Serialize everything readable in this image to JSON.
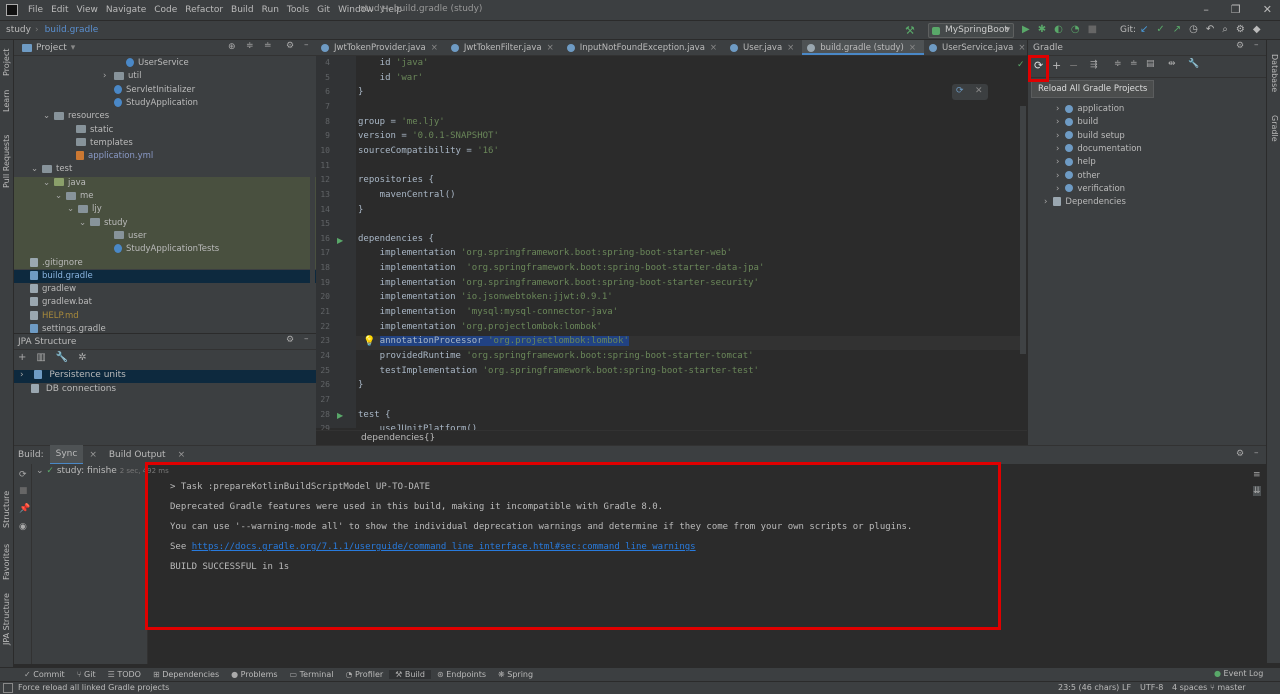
{
  "window": {
    "title": "study - build.gradle (study)"
  },
  "menu": [
    "File",
    "Edit",
    "View",
    "Navigate",
    "Code",
    "Refactor",
    "Build",
    "Run",
    "Tools",
    "Git",
    "Window",
    "Help"
  ],
  "nav": {
    "project": "study",
    "file": "build.gradle",
    "run_config": "MySpringBoot",
    "git_label": "Git:"
  },
  "project_panel": {
    "title": "Project",
    "tree": [
      {
        "label": "UserService",
        "indent": 126,
        "kind": "class"
      },
      {
        "label": "util",
        "indent": 114,
        "kind": "folder",
        "chev": "›"
      },
      {
        "label": "ServletInitializer",
        "indent": 114,
        "kind": "class"
      },
      {
        "label": "StudyApplication",
        "indent": 114,
        "kind": "class"
      },
      {
        "label": "resources",
        "indent": 54,
        "kind": "folder",
        "chev": "⌄"
      },
      {
        "label": "static",
        "indent": 76,
        "kind": "folder"
      },
      {
        "label": "templates",
        "indent": 76,
        "kind": "folder"
      },
      {
        "label": "application.yml",
        "indent": 76,
        "kind": "yml"
      },
      {
        "label": "test",
        "indent": 42,
        "kind": "folder",
        "chev": "⌄"
      },
      {
        "label": "java",
        "indent": 54,
        "kind": "folderg",
        "chev": "⌄"
      },
      {
        "label": "me",
        "indent": 66,
        "kind": "folder",
        "chev": "⌄"
      },
      {
        "label": "ljy",
        "indent": 78,
        "kind": "folder",
        "chev": "⌄"
      },
      {
        "label": "study",
        "indent": 90,
        "kind": "folder",
        "chev": "⌄"
      },
      {
        "label": "user",
        "indent": 114,
        "kind": "folder"
      },
      {
        "label": "StudyApplicationTests",
        "indent": 114,
        "kind": "class"
      },
      {
        "label": ".gitignore",
        "indent": 30,
        "kind": "file"
      },
      {
        "label": "build.gradle",
        "indent": 30,
        "kind": "gradle"
      },
      {
        "label": "gradlew",
        "indent": 30,
        "kind": "file"
      },
      {
        "label": "gradlew.bat",
        "indent": 30,
        "kind": "file"
      },
      {
        "label": "HELP.md",
        "indent": 30,
        "kind": "md"
      },
      {
        "label": "settings.gradle",
        "indent": 30,
        "kind": "gradle"
      }
    ]
  },
  "jpa_panel": {
    "title": "JPA Structure",
    "items": [
      "Persistence units",
      "DB connections"
    ]
  },
  "editor": {
    "tabs": [
      {
        "label": "JwtTokenProvider.java",
        "color": "#6e9bc4"
      },
      {
        "label": "JwtTokenFilter.java",
        "color": "#6e9bc4"
      },
      {
        "label": "InputNotFoundException.java",
        "color": "#6e9bc4"
      },
      {
        "label": "User.java",
        "color": "#6e9bc4"
      },
      {
        "label": "build.gradle (study)",
        "color": "#9aa7b0"
      },
      {
        "label": "UserService.java",
        "color": "#6e9bc4"
      },
      {
        "label": "UserRepository.java",
        "color": "#59a869"
      }
    ],
    "lines": [
      {
        "n": "4",
        "t": "    id 'java'"
      },
      {
        "n": "5",
        "t": "    id 'war'"
      },
      {
        "n": "6",
        "t": "}"
      },
      {
        "n": "7",
        "t": ""
      },
      {
        "n": "8",
        "t": "group = 'me.ljy'"
      },
      {
        "n": "9",
        "t": "version = '0.0.1-SNAPSHOT'"
      },
      {
        "n": "10",
        "t": "sourceCompatibility = '16'"
      },
      {
        "n": "11",
        "t": ""
      },
      {
        "n": "12",
        "t": "repositories {"
      },
      {
        "n": "13",
        "t": "    mavenCentral()"
      },
      {
        "n": "14",
        "t": "}"
      },
      {
        "n": "15",
        "t": ""
      },
      {
        "n": "16",
        "t": "dependencies {"
      },
      {
        "n": "17",
        "t": "    implementation 'org.springframework.boot:spring-boot-starter-web'"
      },
      {
        "n": "18",
        "t": "    implementation  'org.springframework.boot:spring-boot-starter-data-jpa'"
      },
      {
        "n": "19",
        "t": "    implementation 'org.springframework.boot:spring-boot-starter-security'"
      },
      {
        "n": "20",
        "t": "    implementation 'io.jsonwebtoken:jjwt:0.9.1'"
      },
      {
        "n": "21",
        "t": "    implementation  'mysql:mysql-connector-java'"
      },
      {
        "n": "22",
        "t": "    implementation 'org.projectlombok:lombok'"
      },
      {
        "n": "23",
        "t": "    annotationProcessor 'org.projectlombok:lombok'"
      },
      {
        "n": "24",
        "t": "    providedRuntime 'org.springframework.boot:spring-boot-starter-tomcat'"
      },
      {
        "n": "25",
        "t": "    testImplementation 'org.springframework.boot:spring-boot-starter-test'"
      },
      {
        "n": "26",
        "t": "}"
      },
      {
        "n": "27",
        "t": ""
      },
      {
        "n": "28",
        "t": "test {"
      },
      {
        "n": "29",
        "t": "    useJUnitPlatform()"
      }
    ],
    "breadcrumb": "dependencies{}"
  },
  "gradle_panel": {
    "title": "Gradle",
    "tooltip": "Reload All Gradle Projects",
    "tasks": [
      "application",
      "build",
      "build setup",
      "documentation",
      "help",
      "other",
      "verification"
    ],
    "dependencies": "Dependencies"
  },
  "build_panel": {
    "label": "Build:",
    "tabs": [
      "Sync",
      "Build Output"
    ],
    "tree_item": "study: finishe",
    "tree_time": "2 sec, 492 ms",
    "console": {
      "l1": "> Task :prepareKotlinBuildScriptModel UP-TO-DATE",
      "l2": "Deprecated Gradle features were used in this build, making it incompatible with Gradle 8.0.",
      "l3": "You can use '--warning-mode all' to show the individual deprecation warnings and determine if they come from your own scripts or plugins.",
      "l4_prefix": "See ",
      "l4_link": "https://docs.gradle.org/7.1.1/userguide/command_line_interface.html#sec:command_line_warnings",
      "l5": "BUILD SUCCESSFUL in 1s"
    }
  },
  "left_strip": [
    "Project",
    "Learn",
    "Pull Requests",
    "Structure",
    "Favorites",
    "JPA Structure"
  ],
  "right_strip": [
    "Database",
    "Gradle"
  ],
  "bottom_tools": [
    "Commit",
    "Git",
    "TODO",
    "Dependencies",
    "Problems",
    "Terminal",
    "Profiler",
    "Build",
    "Endpoints",
    "Spring"
  ],
  "event_log": "Event Log",
  "status": {
    "message": "Force reload all linked Gradle projects",
    "pos": "23:5 (46 chars)",
    "eol": "LF",
    "enc": "UTF-8",
    "indent": "4 spaces",
    "branch": "master"
  }
}
